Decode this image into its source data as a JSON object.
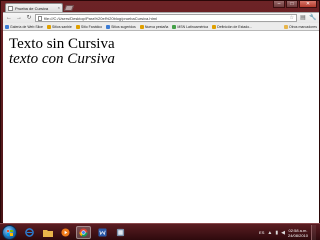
{
  "browser": {
    "tab": {
      "title": "Prueba de Cursiva"
    },
    "window_controls": {
      "minimize": "–",
      "maximize": "□",
      "close": "✕"
    },
    "toolbar": {
      "back_icon": "←",
      "forward_icon": "→",
      "reload_icon": "↻",
      "url": "file:///C:/Users/Desktop/Para%20el%20blog/pruebaCursiva.html",
      "star_icon": "☆",
      "page_menu_icon": "▤",
      "wrench_icon": "🔧"
    },
    "bookmarks": [
      {
        "label": "Galería de Web Slice",
        "color": "#3b7bd4"
      },
      {
        "label": "Sitios sanbie",
        "color": "#e0a000"
      },
      {
        "label": "Sitio Fanático",
        "color": "#e0a000"
      },
      {
        "label": "Sitios sugeridos",
        "color": "#3b7bd4"
      },
      {
        "label": "Nueva pestaña",
        "color": "#e0a000"
      },
      {
        "label": "MSN Latinoamérica",
        "color": "#43a047"
      },
      {
        "label": "Definición de Estado...",
        "color": "#e0a000"
      }
    ],
    "other_bookmarks": "Otros marcadores"
  },
  "page": {
    "line1": "Texto sin Cursiva",
    "line2": "texto con Cursiva"
  },
  "taskbar": {
    "apps": [
      {
        "name": "ie-icon",
        "color": "#2a7fd4"
      },
      {
        "name": "folder-icon",
        "color": "#e8b54a"
      },
      {
        "name": "media-player-icon",
        "color": "#f07a1a"
      },
      {
        "name": "chrome-icon",
        "color": "#4caf50"
      },
      {
        "name": "word-icon",
        "color": "#2b5aa8"
      },
      {
        "name": "app-icon",
        "color": "#7a8fa8"
      }
    ],
    "language": "ES",
    "time": "02:58 a.m.",
    "date": "24/08/2010"
  }
}
